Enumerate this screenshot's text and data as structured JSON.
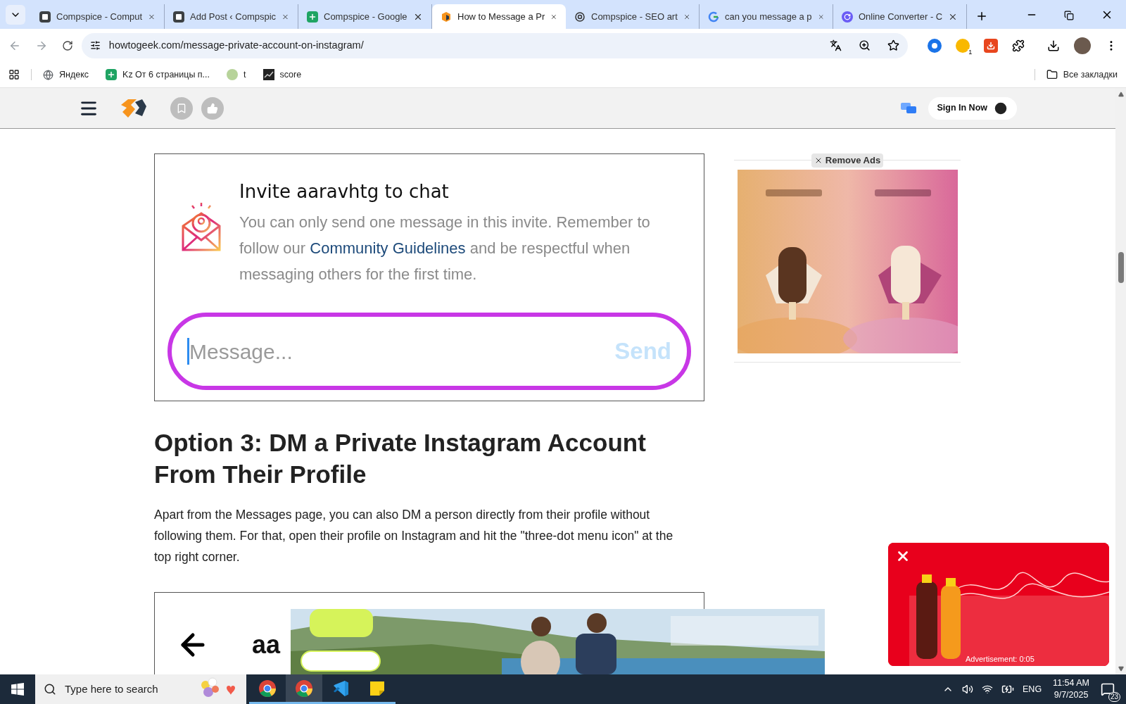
{
  "tabs": [
    {
      "title": "Compspice - Comput",
      "selected": false
    },
    {
      "title": "Add Post ‹ Compspic",
      "selected": false
    },
    {
      "title": "Compspice - Google",
      "selected": false
    },
    {
      "title": "How to Message a Pr",
      "selected": true
    },
    {
      "title": "Compspice - SEO art",
      "selected": false
    },
    {
      "title": "can you message a p",
      "selected": false
    },
    {
      "title": "Online Converter - C",
      "selected": false
    }
  ],
  "address": {
    "url": "howtogeek.com/message-private-account-on-instagram/"
  },
  "bookmarks": [
    {
      "label": "Яндекс"
    },
    {
      "label": "Kz От 6 страницы п..."
    },
    {
      "label": "t"
    },
    {
      "label": "score"
    }
  ],
  "all_bookmarks": "Все закладки",
  "extension_badge": "1",
  "site_header": {
    "sign_in": "Sign In Now"
  },
  "invite": {
    "title": "Invite aaravhtg to chat",
    "text": "You can only send one message in this invite. Remember to follow our ",
    "link": "Community Guidelines",
    "text_end": " and be respectful when messaging others for the first time.",
    "placeholder": "Message...",
    "send": "Send"
  },
  "article": {
    "heading": "Option 3: DM a Private Instagram Account From Their Profile",
    "paragraph": "Apart from the Messages page, you can also DM a person directly from their profile without following them. For that, open their profile on Instagram and hit the \"three-dot menu icon\" at the top right corner.",
    "screenshot_text": "aa"
  },
  "sidebar": {
    "remove_ads": "Remove Ads"
  },
  "video_ad": {
    "label": "Advertisement: 0:05"
  },
  "taskbar": {
    "search_placeholder": "Type here to search",
    "apps": [
      {
        "kind": "chrome",
        "selected": false
      },
      {
        "kind": "chrome",
        "selected": true
      },
      {
        "kind": "vscode",
        "selected": false
      },
      {
        "kind": "notes",
        "selected": false
      }
    ],
    "language": "ENG",
    "time": "11:54 AM",
    "date": "9/7/2025",
    "notifications": "23"
  }
}
